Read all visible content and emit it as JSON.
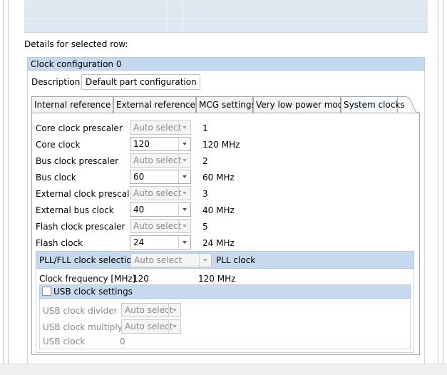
{
  "details_label": "Details for selected row:",
  "group_title": "Clock configuration 0",
  "description": {
    "label": "Description",
    "value": "Default  part configuration"
  },
  "tabs": [
    {
      "label": "Internal reference cl"
    },
    {
      "label": "External reference cl"
    },
    {
      "label": "MCG settings"
    },
    {
      "label": "Very low power mode"
    },
    {
      "label": "System clocks"
    }
  ],
  "rows": [
    {
      "label": "Core clock prescaler",
      "combo": "Auto select",
      "value": "1"
    },
    {
      "label": "Core clock",
      "combo": "120",
      "value": "120 MHz"
    },
    {
      "label": "Bus clock prescaler",
      "combo": "Auto select",
      "value": "2"
    },
    {
      "label": "Bus clock",
      "combo": "60",
      "value": "60 MHz"
    },
    {
      "label": "External clock prescaler",
      "combo": "Auto select",
      "value": "3"
    },
    {
      "label": "External bus clock",
      "combo": "40",
      "value": "40 MHz"
    },
    {
      "label": "Flash clock prescaler",
      "combo": "Auto select",
      "value": "5"
    },
    {
      "label": "Flash clock",
      "combo": "24",
      "value": "24 MHz"
    }
  ],
  "pll": {
    "label": "PLL/FLL clock selection",
    "combo": "Auto select",
    "value": "PLL clock",
    "freq_label": "Clock frequency [MHz]",
    "freq_value": "120",
    "freq_unit": "120 MHz"
  },
  "usb": {
    "title": "USB clock settings",
    "divider_label": "USB clock divider",
    "divider_combo": "Auto select",
    "multiply_label": "USB clock multiply",
    "multiply_combo": "Auto select",
    "clock_label": "USB clock",
    "clock_value": "0"
  }
}
